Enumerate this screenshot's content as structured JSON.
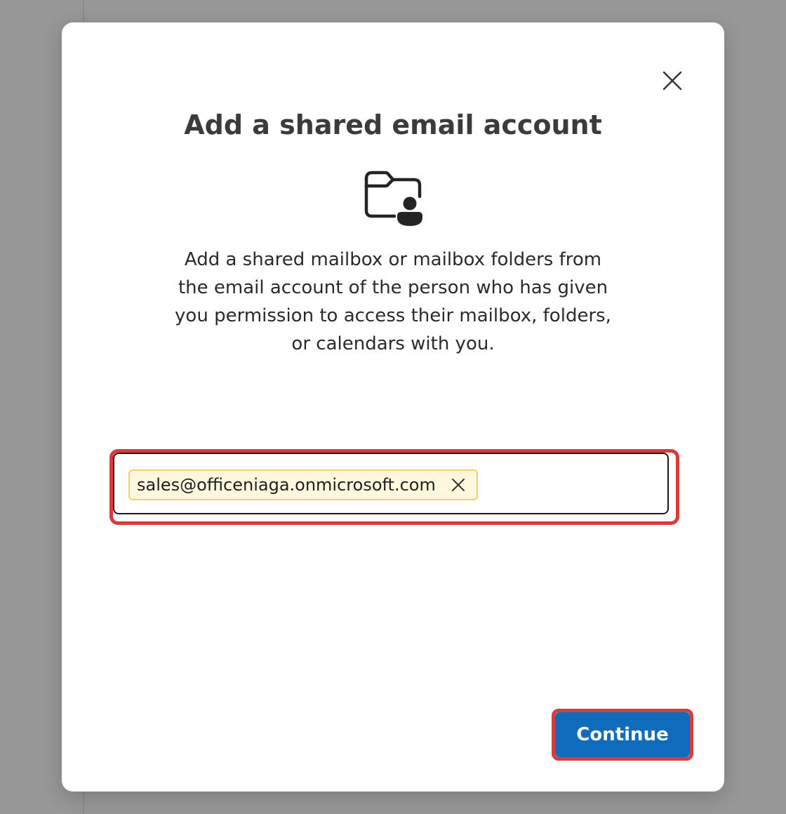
{
  "dialog": {
    "title": "Add a shared email account",
    "description": "Add a shared mailbox or mailbox folders from the email account of the person who has given you permission to access their mailbox, folders, or calendars with you.",
    "icons": {
      "close": "close-icon",
      "hero": "shared-folder-person-icon",
      "chip_remove": "remove-icon"
    },
    "email_field": {
      "chip_value": "sales@officeniaga.onmicrosoft.com"
    },
    "continue_label": "Continue"
  },
  "colors": {
    "accent": "#0f6cbd",
    "highlight": "#d83b3b",
    "chip_background": "#fff8dc",
    "chip_border": "#f2d35a",
    "overlay": "#979797"
  }
}
